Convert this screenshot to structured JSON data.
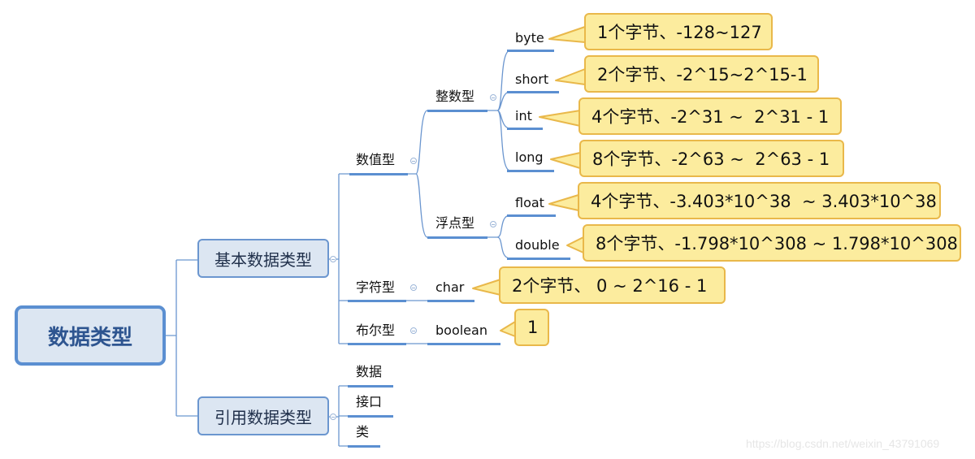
{
  "root": {
    "label": "数据类型"
  },
  "primitive": {
    "label": "基本数据类型",
    "numeric": {
      "label": "数值型",
      "integer": {
        "label": "整数型",
        "items": [
          {
            "name": "byte",
            "note": "1个字节、-128~127"
          },
          {
            "name": "short",
            "note": "2个字节、-2^15~2^15-1"
          },
          {
            "name": "int",
            "note": "4个字节、-2^31 ~  2^31 - 1"
          },
          {
            "name": "long",
            "note": "8个字节、-2^63 ~  2^63 - 1"
          }
        ]
      },
      "float": {
        "label": "浮点型",
        "items": [
          {
            "name": "float",
            "note": "4个字节、-3.403*10^38  ~ 3.403*10^38"
          },
          {
            "name": "double",
            "note": "8个字节、-1.798*10^308 ~ 1.798*10^308"
          }
        ]
      }
    },
    "char": {
      "label": "字符型",
      "name": "char",
      "note": "2个字节、 0 ~ 2^16 - 1"
    },
    "boolean": {
      "label": "布尔型",
      "name": "boolean",
      "note": "1"
    }
  },
  "reference": {
    "label": "引用数据类型",
    "items": [
      "数据",
      "接口",
      "类"
    ]
  },
  "colors": {
    "branch": "#5b8fd1",
    "node_fill": "#dce6f2",
    "callout_fill": "#fcec9e",
    "callout_border": "#e9b84a"
  },
  "watermark": "https://blog.csdn.net/weixin_43791069"
}
